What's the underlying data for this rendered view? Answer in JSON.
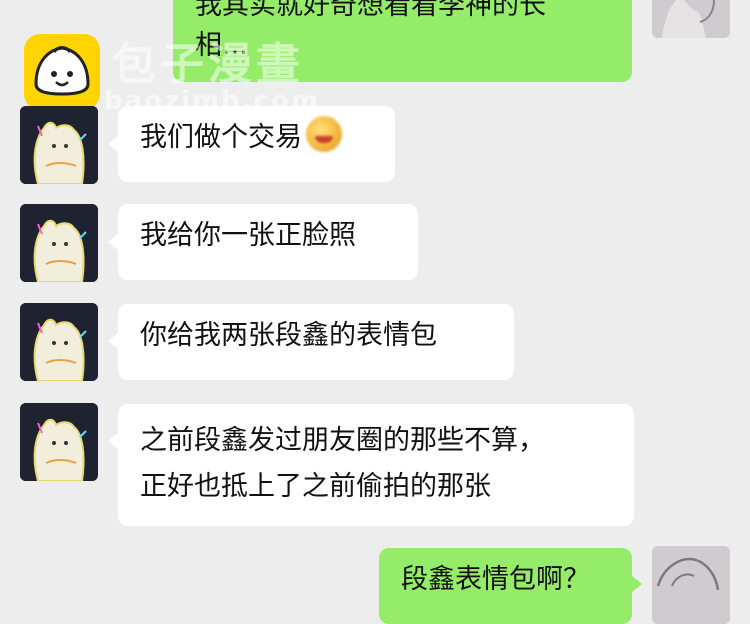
{
  "watermark": {
    "title": "包子漫畫",
    "url": "baozimh.com"
  },
  "messages": [
    {
      "side": "right",
      "lines": [
        "我其实就好奇想看看李神的长",
        "相..."
      ]
    },
    {
      "side": "left",
      "text": "我们做个交易",
      "emoji": "smiling-face-emoji"
    },
    {
      "side": "left",
      "text": "我给你一张正脸照"
    },
    {
      "side": "left",
      "text": "你给我两张段鑫的表情包"
    },
    {
      "side": "left",
      "lines": [
        "之前段鑫发过朋友圈的那些不算，",
        "正好也抵上了之前偷拍的那张"
      ]
    },
    {
      "side": "right",
      "text": "段鑫表情包啊？"
    }
  ],
  "colors": {
    "background": "#ededed",
    "bubble_left": "#ffffff",
    "bubble_right": "#95ec69",
    "watermark_logo": "#ffd400"
  }
}
